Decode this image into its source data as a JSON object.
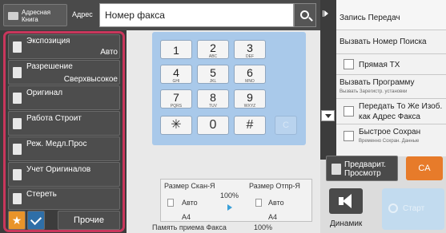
{
  "header": {
    "address_book_label": "Адресная Книга",
    "address_label": "Адрес",
    "fax_number_placeholder": "Номер факса"
  },
  "sidebar": {
    "items": [
      {
        "label": "Экспозиция",
        "value": "Авто"
      },
      {
        "label": "Разрешение",
        "value": "Сверхвысокое"
      },
      {
        "label": "Оригинал",
        "value": ""
      },
      {
        "label": "Работа Строит",
        "value": ""
      },
      {
        "label": "Реж. Медл.Прос",
        "value": ""
      },
      {
        "label": "Учет Оригиналов",
        "value": ""
      },
      {
        "label": "Стереть",
        "value": ""
      }
    ],
    "other_label": "Прочие",
    "star_glyph": "★"
  },
  "keypad": {
    "keys": [
      {
        "num": "1",
        "sub": ""
      },
      {
        "num": "2",
        "sub": "ABC"
      },
      {
        "num": "3",
        "sub": "DEF"
      },
      {
        "num": "4",
        "sub": "GHI"
      },
      {
        "num": "5",
        "sub": "JKL"
      },
      {
        "num": "6",
        "sub": "MNO"
      },
      {
        "num": "7",
        "sub": "PQRS"
      },
      {
        "num": "8",
        "sub": "TUV"
      },
      {
        "num": "9",
        "sub": "WXYZ"
      },
      {
        "num": "✳",
        "sub": ""
      },
      {
        "num": "0",
        "sub": ""
      },
      {
        "num": "#",
        "sub": ""
      }
    ],
    "clear_label": "C"
  },
  "info": {
    "scan_size_label": "Размер Скан-Я",
    "send_size_label": "Размер Отпр-Я",
    "scan_value": "Авто",
    "send_value": "Авто",
    "ratio": "100%",
    "scan_paper": "A4",
    "send_paper": "A4",
    "memory_label": "Память приема Факса",
    "memory_value": "100%"
  },
  "right_panel": {
    "send_log": "Запись Передач",
    "recall_search": "Вызвать Номер Поиска",
    "direct_tx": "Прямая TX",
    "recall_program": "Вызвать Программу",
    "recall_program_sub": "Вызвать Зарегистр. установки",
    "send_same_image": "Передать То Же Изоб. как Адрес Факса",
    "quick_save": "Быстрое Сохран",
    "quick_save_sub": "Временно Сохран. Данные"
  },
  "actions": {
    "preview": "Предварит. Просмотр",
    "ca": "CA",
    "speaker": "Динамик",
    "start": "Старт"
  }
}
